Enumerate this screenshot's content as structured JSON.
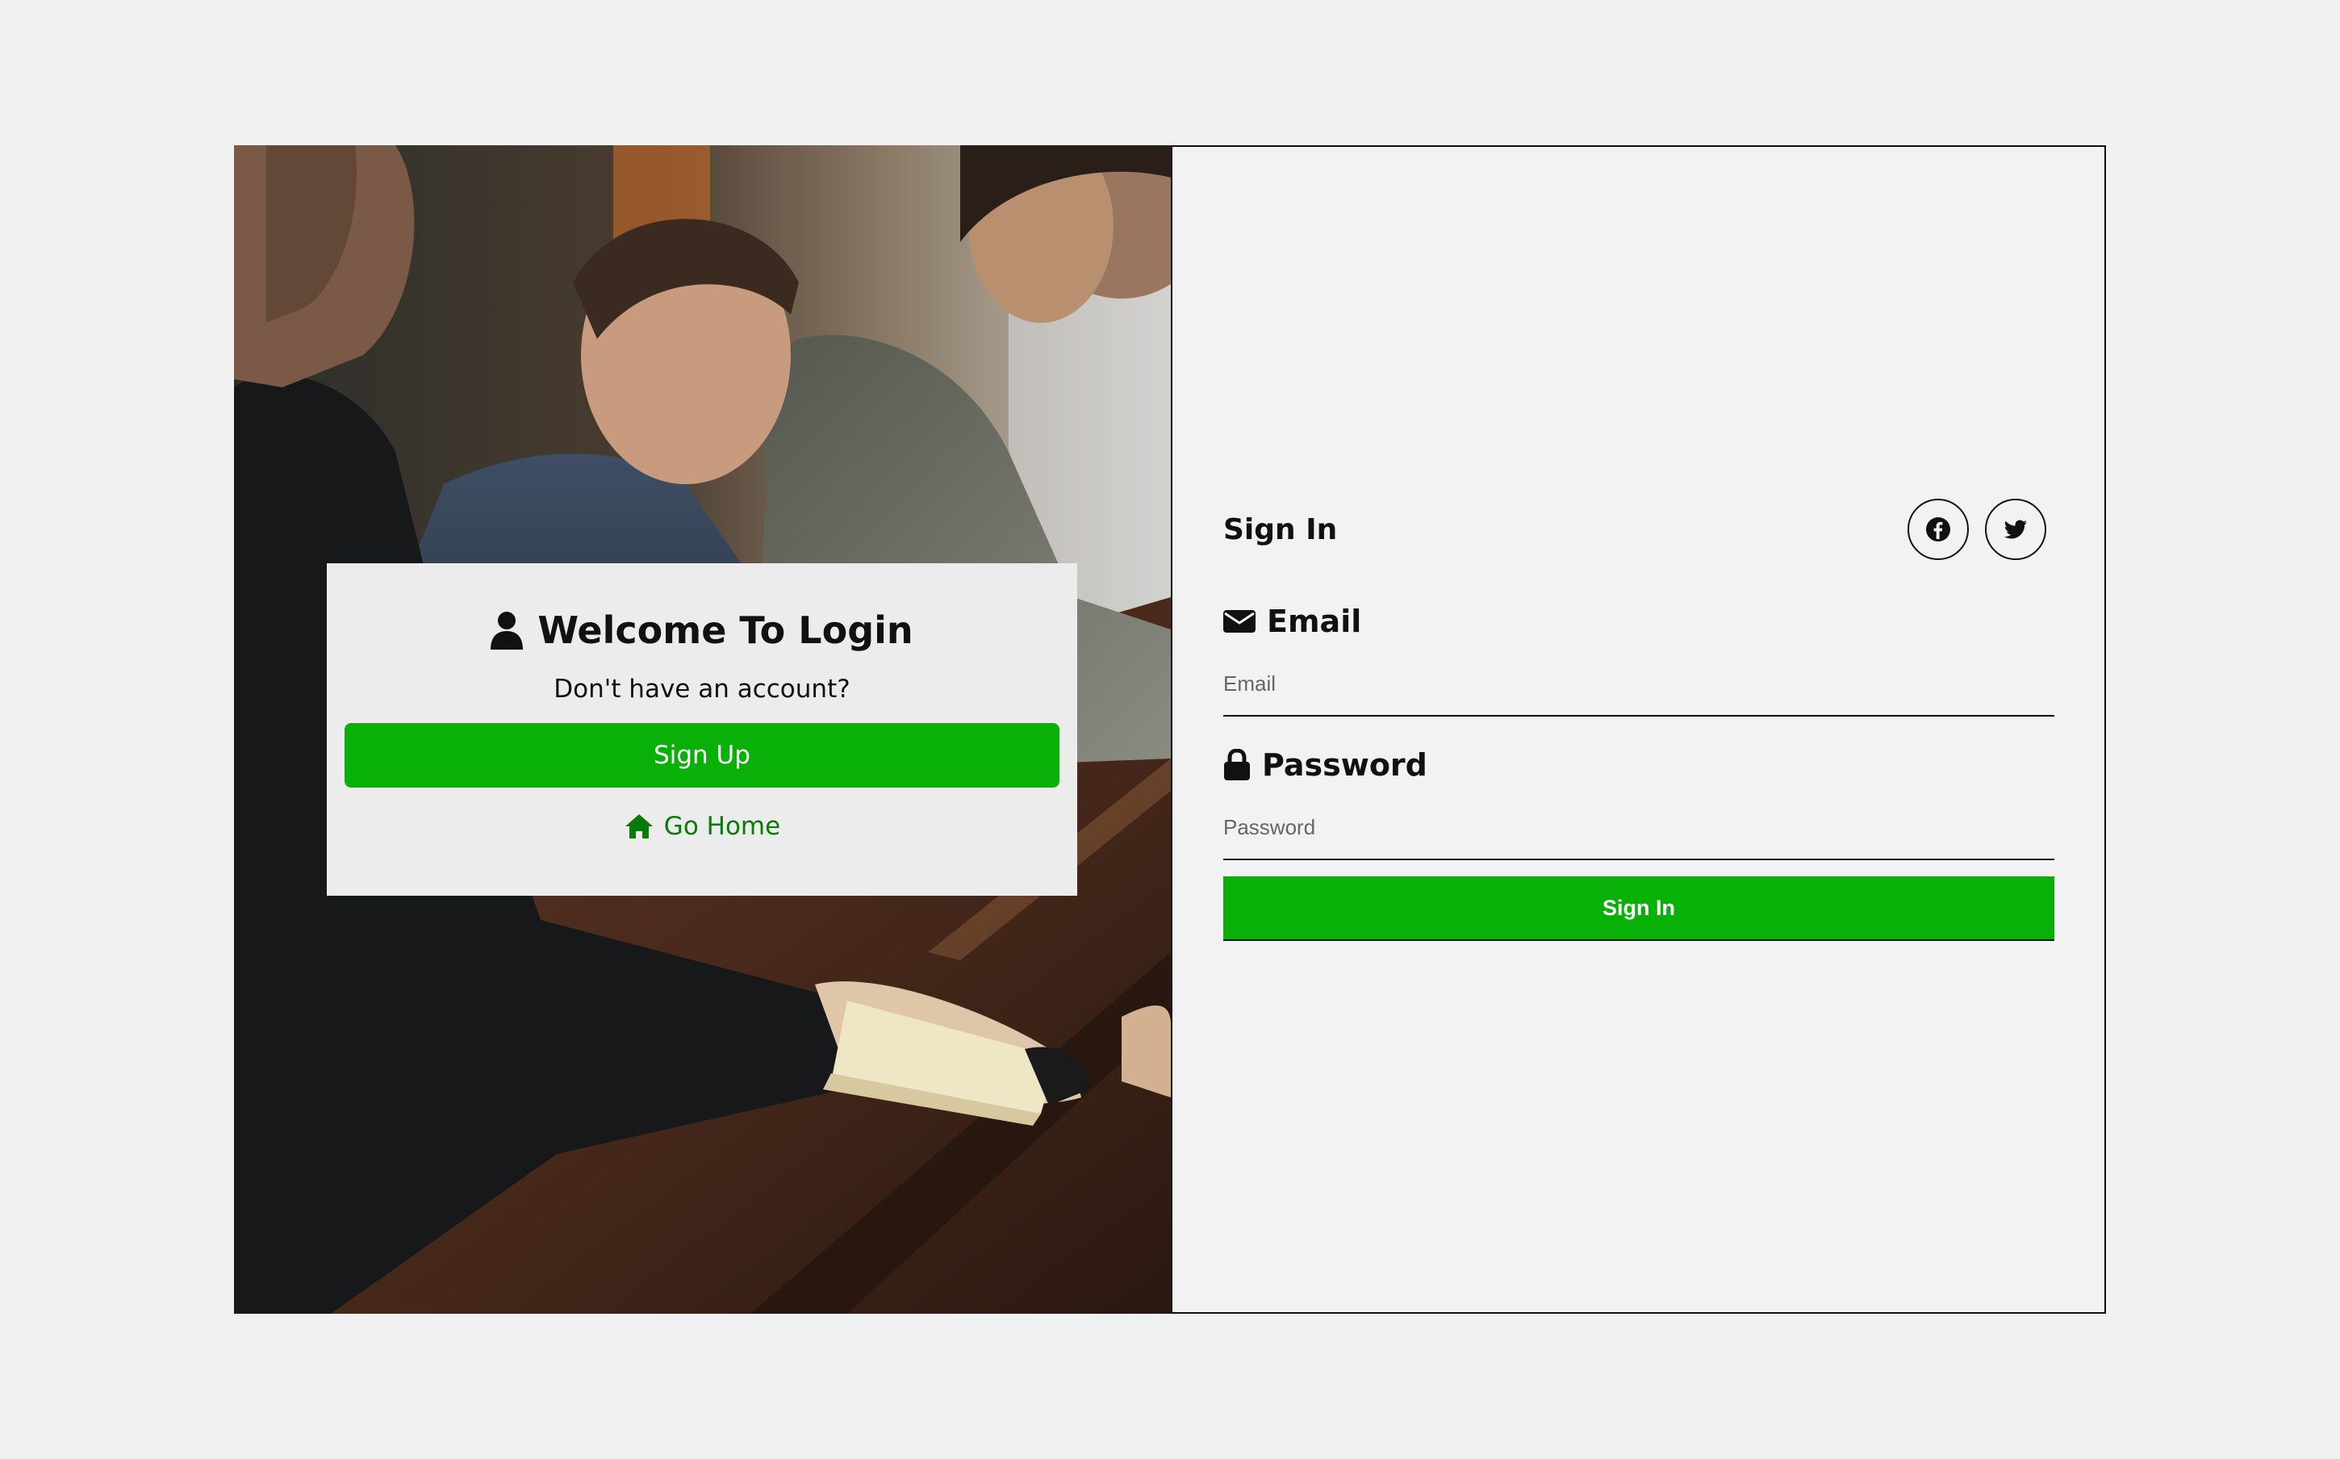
{
  "colors": {
    "page_bg": "#f1f1f1",
    "accent_green": "#08b008",
    "link_green": "#0a7a0a",
    "text": "#111111"
  },
  "photo": {
    "icon": "photo-people-at-table"
  },
  "welcome_card": {
    "icon": "user-icon",
    "title": "Welcome To Login",
    "subtitle": "Don't have an account?",
    "signup_label": "Sign Up",
    "home_icon": "home-icon",
    "go_home_label": "Go Home"
  },
  "signin_form": {
    "heading": "Sign In",
    "social": [
      {
        "icon": "facebook-icon"
      },
      {
        "icon": "twitter-icon"
      }
    ],
    "email": {
      "icon": "envelope-icon",
      "label": "Email",
      "placeholder": "Email",
      "value": ""
    },
    "password": {
      "icon": "lock-icon",
      "label": "Password",
      "placeholder": "Password",
      "value": ""
    },
    "submit_label": "Sign In"
  }
}
